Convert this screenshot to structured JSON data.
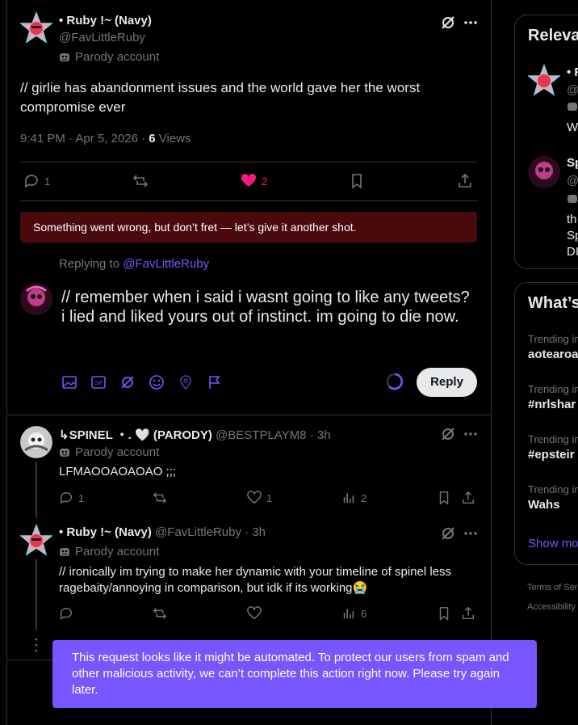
{
  "main_tweet": {
    "display_name": "• Ruby !~ (Navy)",
    "handle": "@FavLittleRuby",
    "badge": "Parody account",
    "text": "// girlie has abandonment issues and the world gave her the worst compromise ever",
    "time": "9:41 PM · Apr 5, 2026 · ",
    "views_count": "6",
    "views_label": " Views",
    "replies": "1",
    "likes": "2",
    "like_color": "#f91880"
  },
  "error_banner": "Something went wrong, but don’t fret — let’s give it another shot.",
  "composer": {
    "replying_prefix": "Replying to ",
    "replying_handle": "@FavLittleRuby",
    "text": "// remember when i said i wasnt going to like any tweets? i lied and liked yours out of instinct. im going to die now.",
    "reply_button": "Reply",
    "accent": "#7856ff"
  },
  "replies": [
    {
      "display_name": "↳SPINEL ・. 🤍 (PARODY)",
      "handle": "@BESTPLAYM8",
      "time": "· 3h",
      "badge": "Parody account",
      "text": "LFMAOOAOAOAO ;;;",
      "replies": "1",
      "likes": "1",
      "views": "2"
    },
    {
      "display_name": "• Ruby !~ (Navy)",
      "handle": "@FavLittleRuby",
      "time": "· 3h",
      "badge": "Parody account",
      "text": "// ironically im trying to make her dynamic with your timeline of spinel less ragebaity/annoying in comparison, but idk if its working😭",
      "views": "6"
    }
  ],
  "sidebar": {
    "relevant_title": "Releva",
    "relevant": [
      {
        "name": "• R",
        "handle": "@",
        "line1": "W"
      },
      {
        "name": "Sp",
        "handle": "@",
        "line1": "th",
        "line2": "Sp",
        "line3": "DI"
      }
    ],
    "whats_title": "What’s",
    "trends": [
      {
        "label": "Trending in",
        "name": "aotearoa"
      },
      {
        "label": "Trending in",
        "name": "#nrlshar"
      },
      {
        "label": "Trending in",
        "name": "#epsteir"
      },
      {
        "label": "Trending in",
        "name": "Wahs"
      }
    ],
    "show_more": "Show mo",
    "footer1": "Terms of Ser",
    "footer2": "Accessibility"
  },
  "toast": "This request looks like it might be automated. To protect our users from spam and other malicious activity, we can’t complete this action right now. Please try again later."
}
